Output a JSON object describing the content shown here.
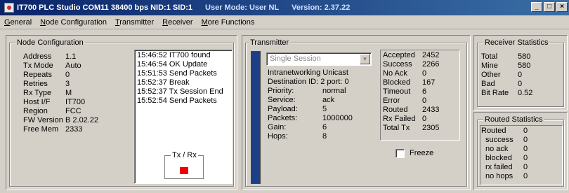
{
  "window": {
    "title": "IT700 PLC Studio  COM11 38400 bps NID:1 SID:1",
    "user_mode": "User Mode: User NL",
    "version": "Version: 2.37.22",
    "buttons": {
      "minimize": "_",
      "maximize": "□",
      "close": "×"
    }
  },
  "menu": [
    "General",
    "Node Configuration",
    "Transmitter",
    "Receiver",
    "More Functions"
  ],
  "node_config": {
    "title": "Node Configuration",
    "fields": [
      {
        "label": "Address",
        "value": "1.1"
      },
      {
        "label": "Tx Mode",
        "value": "Auto"
      },
      {
        "label": "Repeats",
        "value": "0"
      },
      {
        "label": "Retries",
        "value": "3"
      },
      {
        "label": "Rx Type",
        "value": "M"
      },
      {
        "label": "Host I/F",
        "value": "IT700"
      },
      {
        "label": "Region",
        "value": "FCC"
      },
      {
        "label": "FW Version",
        "value": "B 2.02.22"
      },
      {
        "label": "Free Mem",
        "value": "2333"
      }
    ],
    "log": [
      "15:46:52 IT700 found",
      "15:46:54 OK Update",
      "15:51:53 Send Packets",
      "15:52:37 Break",
      "15:52:37 Tx Session End",
      "15:52:54 Send Packets"
    ],
    "txrx_label": "Tx / Rx"
  },
  "transmitter": {
    "title": "Transmitter",
    "session_select": "Single Session",
    "info_title": "Intranetworking Unicast",
    "destination": "Destination ID: 2 port: 0",
    "params": [
      {
        "label": "Priority:",
        "value": "normal"
      },
      {
        "label": "Service:",
        "value": "ack"
      },
      {
        "label": "Payload:",
        "value": "5"
      },
      {
        "label": "Packets:",
        "value": "1000000"
      },
      {
        "label": "Gain:",
        "value": "6"
      },
      {
        "label": "Hops:",
        "value": "8"
      }
    ],
    "stats": [
      {
        "label": "Accepted",
        "value": "2452"
      },
      {
        "label": "Success",
        "value": "2266"
      },
      {
        "label": "No Ack",
        "value": "0"
      },
      {
        "label": "Blocked",
        "value": "167"
      },
      {
        "label": "Timeout",
        "value": "6"
      },
      {
        "label": "Error",
        "value": "0"
      },
      {
        "label": "Routed",
        "value": "2433"
      },
      {
        "label": "Rx Failed",
        "value": "0"
      },
      {
        "label": "Total Tx",
        "value": "2305"
      }
    ],
    "freeze_label": "Freeze"
  },
  "receiver_stats": {
    "title": "Receiver Statistics",
    "rows": [
      {
        "label": "Total",
        "value": "580"
      },
      {
        "label": "Mine",
        "value": "580"
      },
      {
        "label": "Other",
        "value": "0"
      },
      {
        "label": "Bad",
        "value": "0"
      },
      {
        "label": "Bit Rate",
        "value": "0.52"
      }
    ]
  },
  "routed_stats": {
    "title": "Routed Statistics",
    "rows": [
      {
        "label": "Routed",
        "value": "0"
      },
      {
        "label": "success",
        "value": "0"
      },
      {
        "label": "no ack",
        "value": "0"
      },
      {
        "label": "blocked",
        "value": "0"
      },
      {
        "label": "rx failed",
        "value": "0"
      },
      {
        "label": "no hops",
        "value": "0"
      }
    ]
  },
  "colors": {
    "titlebar_start": "#0a246a",
    "titlebar_end": "#3a6ea5",
    "face": "#d4d0c8",
    "session_bar": "#1d3f87",
    "led": "#ee0000"
  }
}
